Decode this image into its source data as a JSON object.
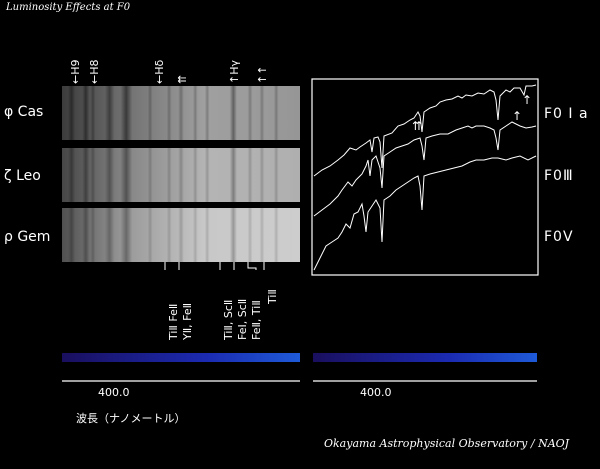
{
  "title": "Luminosity Effects at F0",
  "credit": "Okayama Astrophysical Observatory / NAOJ",
  "stars": [
    {
      "name": "φ Cas",
      "class": "F0 I a"
    },
    {
      "name": "ζ Leo",
      "class": "F0Ⅲ"
    },
    {
      "name": "ρ Gem",
      "class": "F0Ⅴ"
    }
  ],
  "top_markers": [
    "←H9",
    "←H8",
    "←Hδ",
    "⇈",
    "↑Hγ",
    "↑↑"
  ],
  "bottom_labels": [
    "TiⅡ FeⅡ",
    "YⅡ, FeⅡ",
    "TiⅡ, ScⅡ",
    "FeⅠ, ScⅡ",
    "FeⅡ, TiⅡ",
    "TiⅡ"
  ],
  "spectrum_markers": [
    "⇈",
    "↑",
    "↑"
  ],
  "wavelength_label": "400.0",
  "axis_title": "波長（ナノメートル）"
}
